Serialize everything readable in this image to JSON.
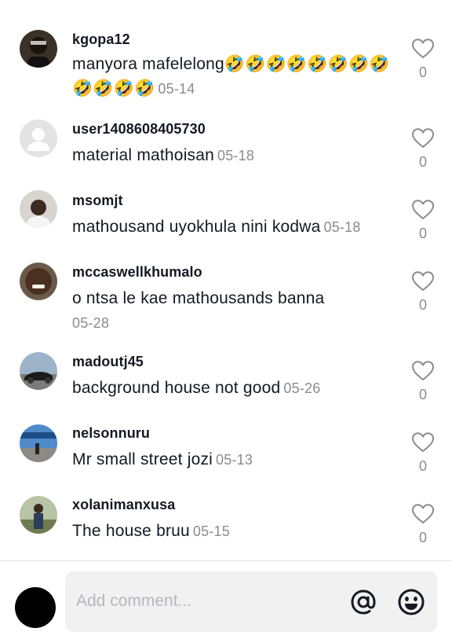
{
  "comments": [
    {
      "username": "kgopa12",
      "text": "manyora mafelelong🤣🤣🤣🤣🤣🤣🤣🤣🤣🤣🤣🤣",
      "date": "05-14",
      "likes": "0"
    },
    {
      "username": "user1408608405730",
      "text": "material mathoisan",
      "date": "05-18",
      "likes": "0"
    },
    {
      "username": "msomjt",
      "text": "mathousand uyokhula nini kodwa",
      "date": "05-18",
      "likes": "0"
    },
    {
      "username": "mccaswellkhumalo",
      "text": "o ntsa le kae mathousands banna",
      "date": "05-28",
      "likes": "0"
    },
    {
      "username": "madoutj45",
      "text": "background house not good",
      "date": "05-26",
      "likes": "0"
    },
    {
      "username": "nelsonnuru",
      "text": "Mr small street jozi",
      "date": "05-13",
      "likes": "0"
    },
    {
      "username": "xolanimanxusa",
      "text": "The house bruu",
      "date": "05-15",
      "likes": "0"
    }
  ],
  "composer": {
    "placeholder": "Add comment...",
    "mention_icon": "at-sign-icon",
    "emoji_icon": "emoji-icon"
  },
  "colors": {
    "text_primary": "#161823",
    "text_secondary": "#8a8b91",
    "input_bg": "#f1f1f2",
    "placeholder": "#b6b7bb"
  }
}
